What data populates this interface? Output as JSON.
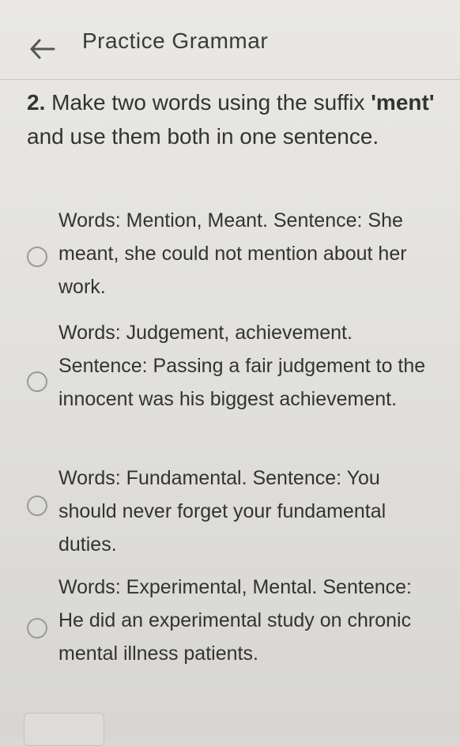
{
  "header": {
    "back_icon": "arrow-left-icon",
    "title": "Practice Grammar"
  },
  "question": {
    "number": "2.",
    "text_before": " Make two words using the suffix ",
    "keyword": "'ment'",
    "text_after": " and use them both in one sentence."
  },
  "options": [
    {
      "label": "Words: Mention, Meant. Sentence: She meant, she could not mention about her work.",
      "selected": false
    },
    {
      "label": "Words: Judgement, achievement. Sentence: Passing a fair judgement to the innocent was his biggest achievement.",
      "selected": false
    },
    {
      "label": "Words: Fundamental. Sentence: You should never forget your fundamental duties.",
      "selected": false
    },
    {
      "label": "Words: Experimental, Mental. Sentence: He did an experimental study on chronic mental illness patients.",
      "selected": false
    }
  ]
}
